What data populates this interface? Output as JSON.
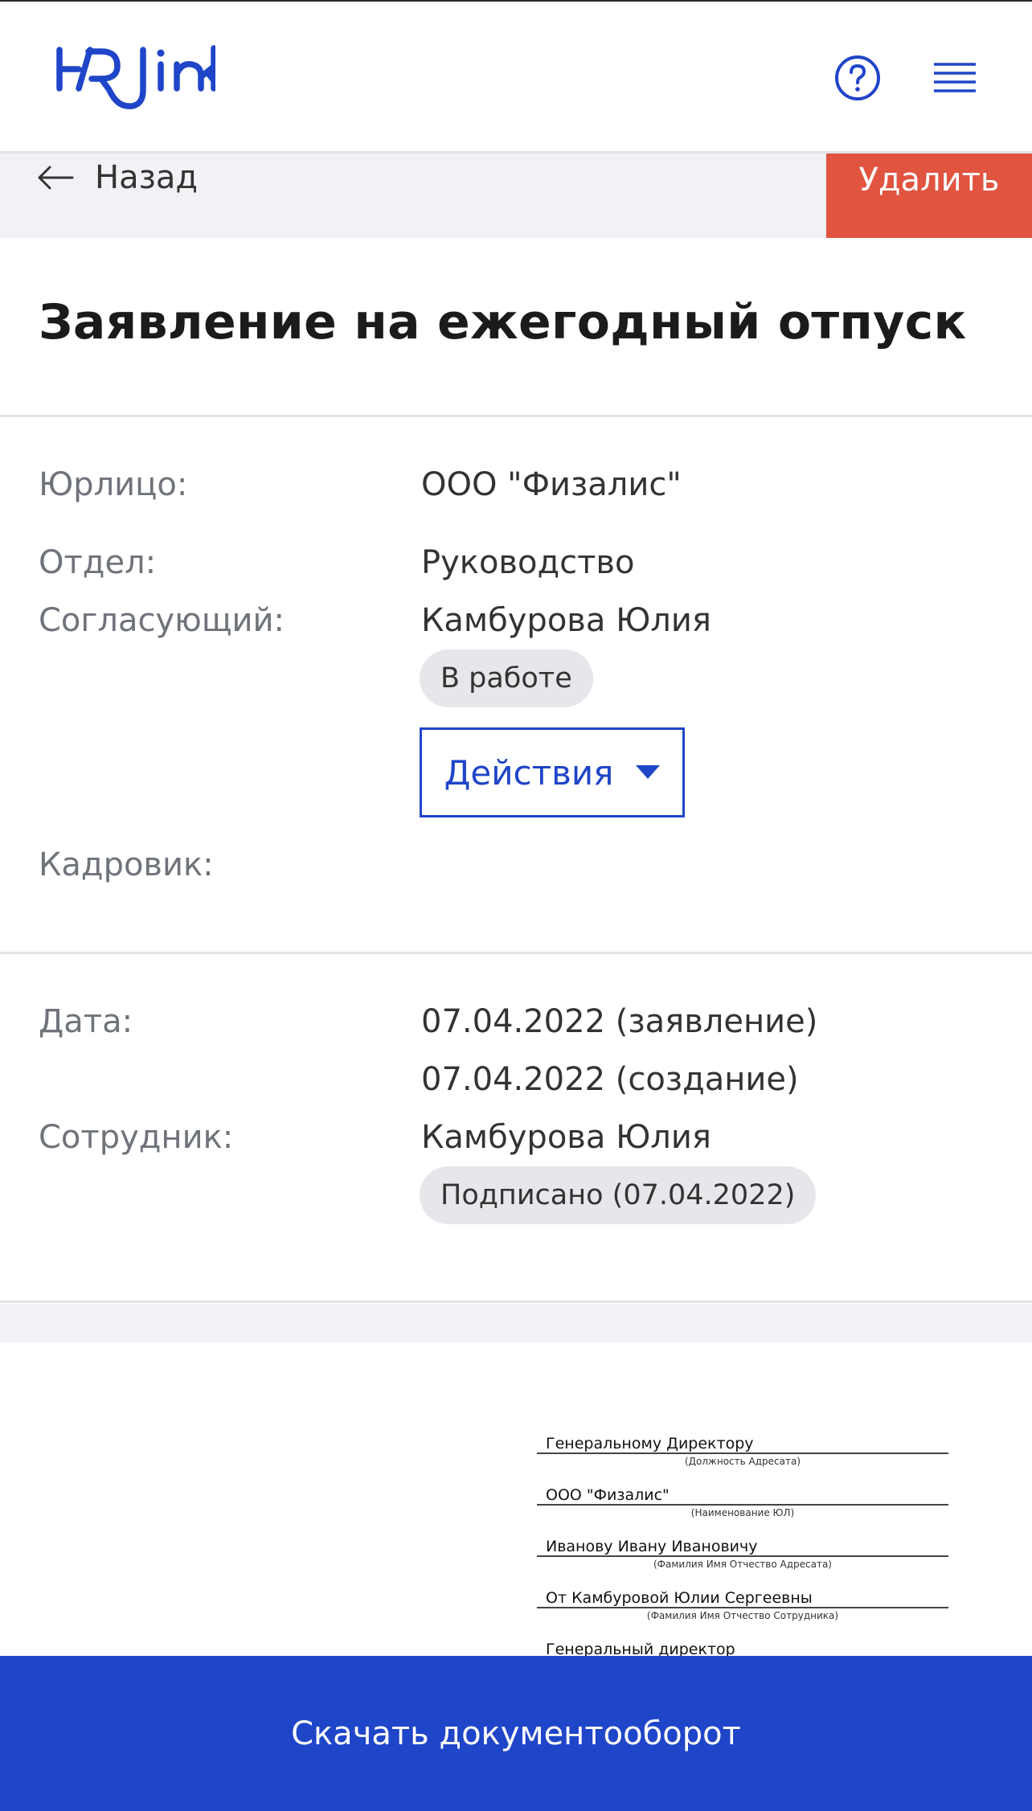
{
  "header": {
    "logo_text": "HRlink",
    "brand_color": "#1f45c9",
    "help_icon": "question-circle-icon",
    "menu_icon": "hamburger-menu-icon"
  },
  "nav": {
    "back_label": "Назад",
    "back_icon": "arrow-left-icon",
    "delete_label": "Удалить",
    "delete_color": "#e05440"
  },
  "document": {
    "title": "Заявление на ежегодный отпуск"
  },
  "info": {
    "legal_entity_label": "Юрлицо:",
    "legal_entity_value": "ООО \"Физалис\"",
    "department_label": "Отдел:",
    "department_value": "Руководство",
    "approver_label": "Согласующий:",
    "approver_name": "Камбурова Юлия",
    "approver_status": "В работе",
    "actions_label": "Действия",
    "actions_icon": "caret-down-icon",
    "hr_label": "Кадровик:"
  },
  "dates": {
    "date_label": "Дата:",
    "date_statement": "07.04.2022 (заявление)",
    "date_created": "07.04.2022 (создание)",
    "employee_label": "Сотрудник:",
    "employee_name": "Камбурова Юлия",
    "employee_status": "Подписано (07.04.2022)"
  },
  "preview": {
    "line1": "Генеральному Директору",
    "caption1": "(Должность Адресата)",
    "line2": "ООО \"Физалис\"",
    "caption2": "(Наименование ЮЛ)",
    "line3": "Иванову Ивану Ивановичу",
    "caption3": "(Фамилия Имя Отчество Адресата)",
    "line4": "От Камбуровой Юлии Сергеевны",
    "caption4": "(Фамилия Имя Отчество Сотрудника)",
    "line5": "Генеральный директор"
  },
  "footer": {
    "download_label": "Скачать документооборот"
  }
}
